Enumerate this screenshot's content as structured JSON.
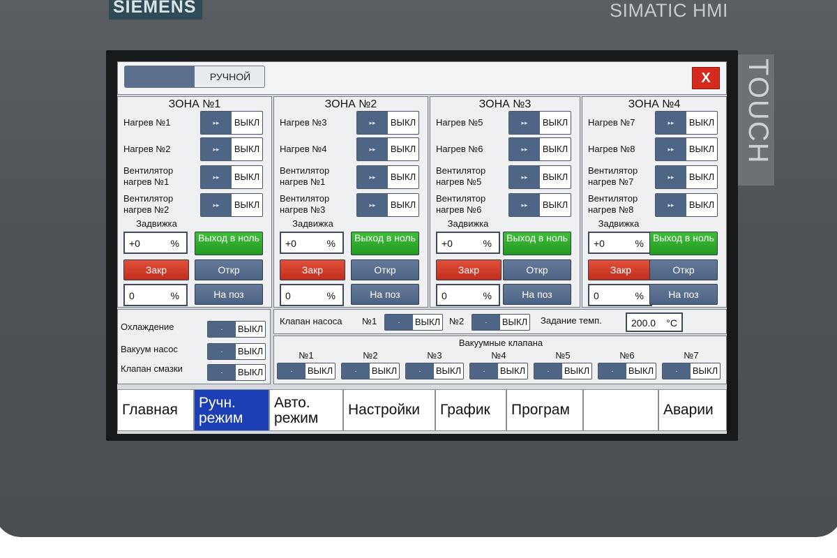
{
  "device": {
    "brand": "SIEMENS",
    "model": "SIMATIC HMI",
    "side_label": "TOUCH"
  },
  "header": {
    "mode_label": "РУЧНОЙ",
    "close_label": "X"
  },
  "zones": [
    {
      "title": "ЗОНА №1",
      "heaters": [
        {
          "label": "Нагрев №1",
          "state": "ВЫКЛ"
        },
        {
          "label": "Нагрев №2",
          "state": "ВЫКЛ"
        },
        {
          "label": "Вентилятор нагрев №1",
          "state": "ВЫКЛ"
        },
        {
          "label": "Вентилятор нагрев №2",
          "state": "ВЫКЛ"
        }
      ],
      "valve_label": "Задвижка",
      "position_value": "+0",
      "position_unit": "%",
      "zero_label": "Выход в ноль",
      "close_label": "Закр",
      "open_label": "Откр",
      "setpoint_value": "0",
      "setpoint_unit": "%",
      "goto_label": "На поз"
    },
    {
      "title": "ЗОНА №2",
      "heaters": [
        {
          "label": "Нагрев №3",
          "state": "ВЫКЛ"
        },
        {
          "label": "Нагрев №4",
          "state": "ВЫКЛ"
        },
        {
          "label": "Вентилятор нагрев №1",
          "state": "ВЫКЛ"
        },
        {
          "label": "Вентилятор нагрев №3",
          "state": "ВЫКЛ"
        }
      ],
      "valve_label": "Задвижка",
      "position_value": "+0",
      "position_unit": "%",
      "zero_label": "Выход в ноль",
      "close_label": "Закр",
      "open_label": "Откр",
      "setpoint_value": "0",
      "setpoint_unit": "%",
      "goto_label": "На поз"
    },
    {
      "title": "ЗОНА №3",
      "heaters": [
        {
          "label": "Нагрев №5",
          "state": "ВЫКЛ"
        },
        {
          "label": "Нагрев №6",
          "state": "ВЫКЛ"
        },
        {
          "label": "Вентилятор нагрев №5",
          "state": "ВЫКЛ"
        },
        {
          "label": "Вентилятор нагрев №6",
          "state": "ВЫКЛ"
        }
      ],
      "valve_label": "Задвижка",
      "position_value": "+0",
      "position_unit": "%",
      "zero_label": "Выход в ноль",
      "close_label": "Закр",
      "open_label": "Откр",
      "setpoint_value": "0",
      "setpoint_unit": "%",
      "goto_label": "На поз"
    },
    {
      "title": "ЗОНА №4",
      "heaters": [
        {
          "label": "Нагрев №7",
          "state": "ВЫКЛ"
        },
        {
          "label": "Нагрев №8",
          "state": "ВЫКЛ"
        },
        {
          "label": "Вентилятор нагрев №7",
          "state": "ВЫКЛ"
        },
        {
          "label": "Вентилятор нагрев №8",
          "state": "ВЫКЛ"
        }
      ],
      "valve_label": "Задвижка",
      "position_value": "+0",
      "position_unit": "%",
      "zero_label": "Выход в ноль",
      "close_label": "Закр",
      "open_label": "Откр",
      "setpoint_value": "0",
      "setpoint_unit": "%",
      "goto_label": "На поз"
    }
  ],
  "utilities": [
    {
      "label": "Охлаждение",
      "state": "ВЫКЛ"
    },
    {
      "label": "Вакуум насос",
      "state": "ВЫКЛ"
    },
    {
      "label": "Клапан смазки",
      "state": "ВЫКЛ"
    }
  ],
  "pump_valves": {
    "label": "Клапан насоса",
    "items": [
      {
        "label": "№1",
        "state": "ВЫКЛ"
      },
      {
        "label": "№2",
        "state": "ВЫКЛ"
      }
    ],
    "temp_label": "Задание темп.",
    "temp_value": "200.0",
    "temp_unit": "°C"
  },
  "vacuum_valves": {
    "title": "Вакуумные клапана",
    "items": [
      {
        "label": "№1",
        "state": "ВЫКЛ"
      },
      {
        "label": "№2",
        "state": "ВЫКЛ"
      },
      {
        "label": "№3",
        "state": "ВЫКЛ"
      },
      {
        "label": "№4",
        "state": "ВЫКЛ"
      },
      {
        "label": "№5",
        "state": "ВЫКЛ"
      },
      {
        "label": "№6",
        "state": "ВЫКЛ"
      },
      {
        "label": "№7",
        "state": "ВЫКЛ"
      }
    ]
  },
  "nav": [
    {
      "label": "Главная",
      "active": false
    },
    {
      "label": "Ручн. режим",
      "active": true
    },
    {
      "label": "Авто. режим",
      "active": false
    },
    {
      "label": "Настройки",
      "active": false
    },
    {
      "label": "График",
      "active": false
    },
    {
      "label": "Програм",
      "active": false
    },
    {
      "label": "",
      "active": false
    },
    {
      "label": "Аварии",
      "active": false
    }
  ],
  "colors": {
    "bezel": "#4f5356",
    "screen_bg": "#d5d8dc",
    "toggle_knob": "#4f6585",
    "button_green": "#2da82a",
    "button_red": "#d03a27",
    "button_blue": "#58708f",
    "nav_active": "#1c3fb5",
    "close_red": "#d42b1e"
  }
}
